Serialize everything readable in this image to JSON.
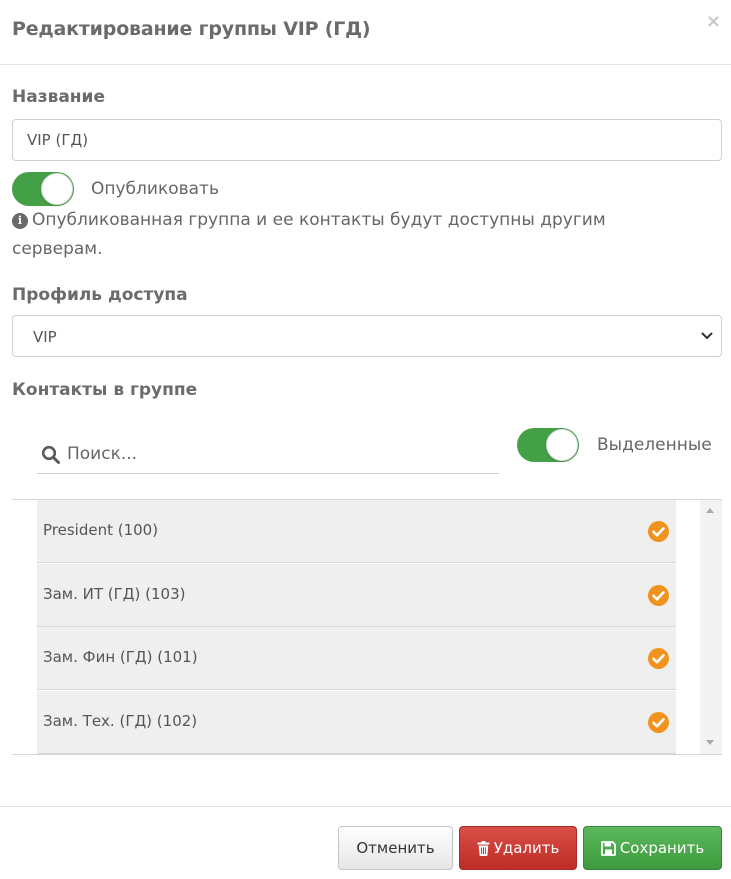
{
  "header": {
    "title": "Редактирование группы VIP (ГД)",
    "close_glyph": "×"
  },
  "form": {
    "name_label": "Название",
    "name_value": "VIP (ГД)",
    "publish_label": "Опубликовать",
    "publish_enabled": true,
    "info_text": "Опубликованная группа и ее контакты будут доступны другим серверам.",
    "access_profile_label": "Профиль доступа",
    "access_profile_value": "VIP",
    "contacts_label": "Контакты в группе"
  },
  "search": {
    "placeholder": "Поиск...",
    "selected_toggle_label": "Выделенные",
    "selected_toggle_enabled": true
  },
  "contacts": [
    {
      "label": "President (100)",
      "checked": true
    },
    {
      "label": "Зам. ИТ (ГД) (103)",
      "checked": true
    },
    {
      "label": "Зам. Фин (ГД) (101)",
      "checked": true
    },
    {
      "label": "Зам. Тех. (ГД) (102)",
      "checked": true
    }
  ],
  "footer": {
    "cancel_label": "Отменить",
    "delete_label": "Удалить",
    "save_label": "Сохранить"
  },
  "colors": {
    "toggle_on": "#43a047",
    "check": "#f0931e",
    "delete": "#c9302c",
    "save": "#4cae4c"
  },
  "icons": {
    "close": "close-icon",
    "info": "info-circle-icon",
    "chevron": "chevron-down-icon",
    "search": "search-icon",
    "check": "check-circle-icon",
    "delete": "trash-icon",
    "save": "floppy-disk-icon"
  }
}
